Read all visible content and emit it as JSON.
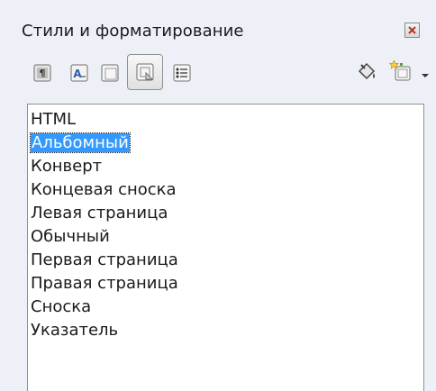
{
  "window": {
    "title": "Стили и форматирование"
  },
  "toolbar": {
    "buttons": [
      {
        "name": "paragraph-styles",
        "icon": "paragraph-styles-icon"
      },
      {
        "name": "character-styles",
        "icon": "character-styles-icon"
      },
      {
        "name": "frame-styles",
        "icon": "frame-styles-icon"
      },
      {
        "name": "page-styles",
        "icon": "page-styles-icon",
        "pressed": true
      },
      {
        "name": "list-styles",
        "icon": "list-styles-icon"
      }
    ],
    "right_buttons": [
      {
        "name": "fill-format-mode",
        "icon": "paint-bucket-icon"
      },
      {
        "name": "new-style-from-selection",
        "icon": "new-style-icon"
      }
    ]
  },
  "styles_list": {
    "items": [
      {
        "label": "HTML"
      },
      {
        "label": "Альбомный",
        "selected": true
      },
      {
        "label": "Конверт"
      },
      {
        "label": "Концевая сноска"
      },
      {
        "label": "Левая страница"
      },
      {
        "label": "Обычный"
      },
      {
        "label": "Первая страница"
      },
      {
        "label": "Правая страница"
      },
      {
        "label": "Сноска"
      },
      {
        "label": "Указатель"
      }
    ]
  },
  "colors": {
    "panel_bg": "#edf1f7",
    "selection_bg": "#3399ff",
    "selection_text": "#ffffff",
    "list_border": "#8e8f8f"
  }
}
